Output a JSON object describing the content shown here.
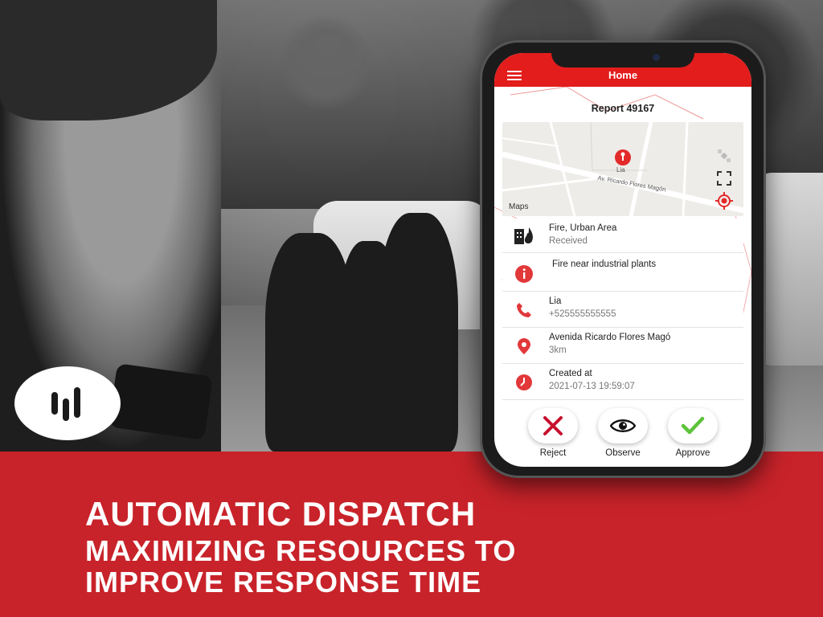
{
  "app": {
    "title": "Home",
    "report_title": "Report 49167"
  },
  "map": {
    "pin_label": "Lia",
    "street_label": "Av. Ricardo Flores Magón",
    "attribution": "Maps"
  },
  "incident": {
    "type": "Fire, Urban Area",
    "status": "Received",
    "description": "Fire near industrial plants",
    "contact_name": "Lia",
    "contact_phone": "+525555555555",
    "address": "Avenida Ricardo Flores Magó",
    "distance": "3km",
    "created_label": "Created at",
    "created_at": "2021-07-13 19:59:07"
  },
  "actions": {
    "reject": "Reject",
    "observe": "Observe",
    "approve": "Approve"
  },
  "headline": {
    "line1": "AUTOMATIC DISPATCH",
    "line2": "MAXIMIZING RESOURCES TO",
    "line3": "IMPROVE RESPONSE TIME"
  },
  "colors": {
    "brand_red": "#c8232a",
    "app_red": "#e31c1c",
    "approve_green": "#5cc23a",
    "reject_red": "#c8102e"
  },
  "icons": [
    "menu-icon",
    "map-pin-icon",
    "satellite-icon",
    "expand-icon",
    "locate-icon",
    "fire-building-icon",
    "info-icon",
    "phone-icon",
    "location-icon",
    "clock-icon",
    "reject-x-icon",
    "eye-icon",
    "check-icon",
    "brand-logo"
  ]
}
